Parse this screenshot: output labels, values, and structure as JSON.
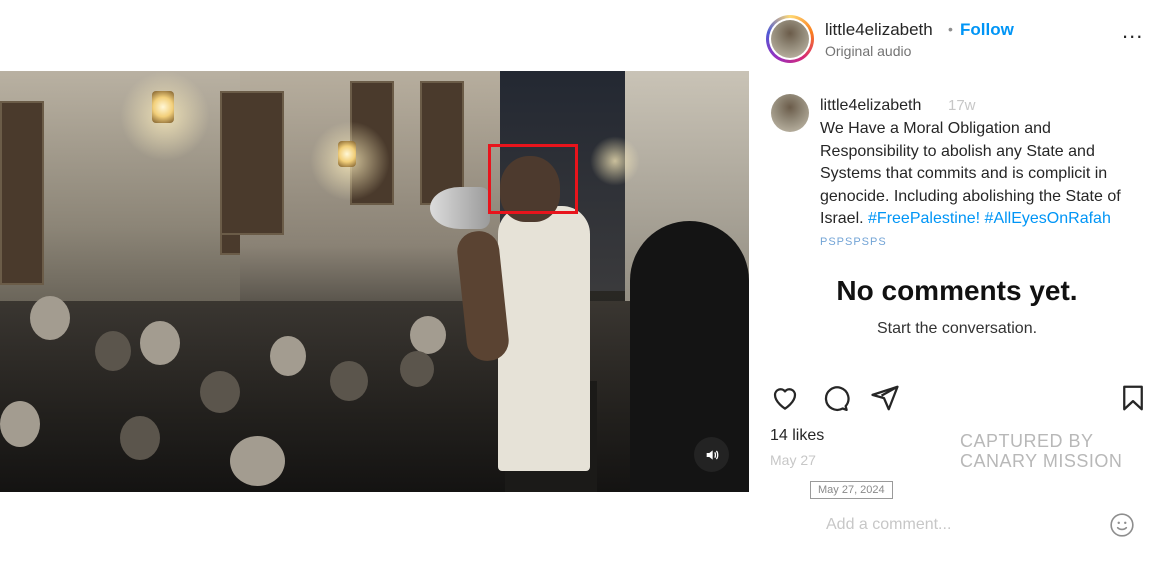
{
  "post": {
    "username": "little4elizabeth",
    "separator": "•",
    "follow_label": "Follow",
    "audio_label": "Original audio",
    "more_label": "..."
  },
  "caption": {
    "username": "little4elizabeth",
    "age": "17w",
    "text": "We Have a Moral Obligation and Responsibility to abolish any State and Systems that commits and is complicit in genocide. Including abolishing the State of Israel.",
    "hashtag_1": "#FreePalestine!",
    "hashtag_2": "#AllEyesOnRafah",
    "tags": "PSPSPSPS"
  },
  "comments": {
    "empty_title": "No comments yet.",
    "empty_subtitle": "Start the conversation."
  },
  "stats": {
    "likes": "14 likes",
    "date": "May 27",
    "date_tooltip": "May 27, 2024"
  },
  "watermark": {
    "line1": "CAPTURED BY",
    "line2": "CANARY MISSION"
  },
  "add_comment": {
    "placeholder": "Add a comment..."
  },
  "icons": {
    "like": "heart-icon",
    "comment": "comment-icon",
    "share": "share-icon",
    "save": "bookmark-icon",
    "sound": "speaker-icon",
    "emoji": "emoji-icon"
  },
  "colors": {
    "accent": "#0095f6",
    "highlight_box": "#e8141c"
  }
}
